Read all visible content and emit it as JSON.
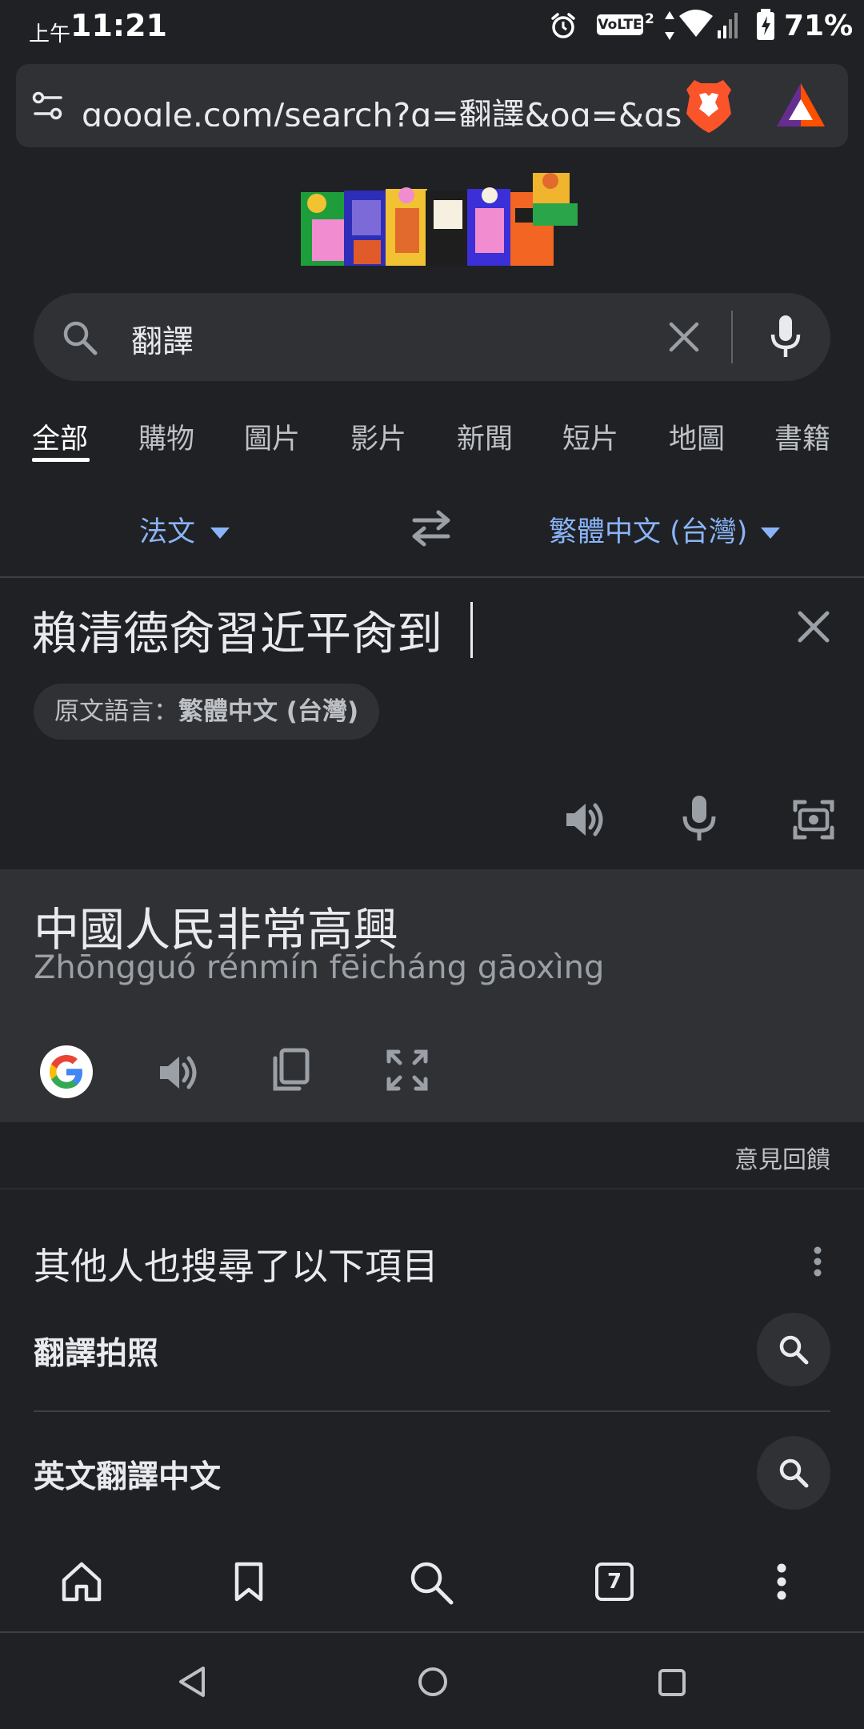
{
  "status_bar": {
    "ampm": "上午",
    "time": "11:21",
    "network_badge": "VoLTE",
    "sim_index": "2",
    "battery": "71%"
  },
  "address_bar": {
    "url": "google.com/search?q=翻譯&oq=&gs_lcr",
    "icons": [
      "site-settings-icon",
      "brave-shields-icon",
      "brave-rewards-icon"
    ]
  },
  "search": {
    "query": "翻譯"
  },
  "tabs": [
    {
      "label": "全部",
      "active": true
    },
    {
      "label": "購物"
    },
    {
      "label": "圖片"
    },
    {
      "label": "影片"
    },
    {
      "label": "新聞"
    },
    {
      "label": "短片"
    },
    {
      "label": "地圖"
    },
    {
      "label": "書籍"
    }
  ],
  "translator": {
    "source_lang": "法文",
    "target_lang": "繁體中文 (台灣)",
    "source_text": "賴清德肏習近平肏到",
    "detected_prefix": "原文語言：",
    "detected_lang": "繁體中文 (台灣)",
    "result_text": "中國人民非常高興",
    "result_pinyin": "Zhōngguó rénmín fēicháng gāoxìng",
    "feedback": "意見回饋",
    "accent_color": "#8ab4f8"
  },
  "people_also_search": {
    "title": "其他人也搜尋了以下項目",
    "items": [
      "翻譯拍照",
      "英文翻譯中文"
    ]
  },
  "toolbar": {
    "tab_count": "7"
  }
}
